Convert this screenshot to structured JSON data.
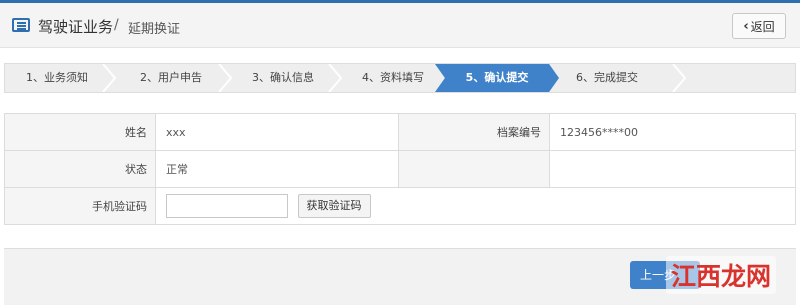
{
  "header": {
    "title": "驾驶证业务",
    "separator": "/",
    "subtitle": "延期换证",
    "back_label": "返回"
  },
  "steps": [
    {
      "label": "1、业务须知",
      "active": false
    },
    {
      "label": "2、用户申告",
      "active": false
    },
    {
      "label": "3、确认信息",
      "active": false
    },
    {
      "label": "4、资料填写",
      "active": false
    },
    {
      "label": "5、确认提交",
      "active": true
    },
    {
      "label": "6、完成提交",
      "active": false
    }
  ],
  "form": {
    "name_label": "姓名",
    "name_value": "xxx",
    "file_no_label": "档案编号",
    "file_no_value": "123456****00",
    "status_label": "状态",
    "status_value": "正常",
    "phone_code_label": "手机验证码",
    "phone_code_value": "",
    "get_code_label": "获取验证码"
  },
  "footer": {
    "prev_label": "上一步"
  },
  "watermark": {
    "text": "江西龙网"
  },
  "colors": {
    "accent": "#3f82c9",
    "topline": "#2f6fb0",
    "watermark_red": "#d8332c"
  }
}
